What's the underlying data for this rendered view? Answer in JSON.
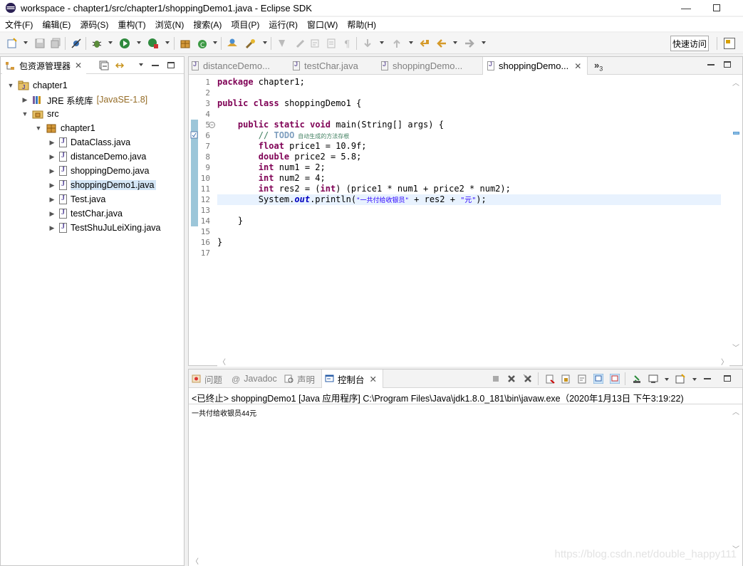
{
  "window": {
    "title": "workspace - chapter1/src/chapter1/shoppingDemo1.java - Eclipse SDK",
    "minimize": "—"
  },
  "menu": [
    "文件(F)",
    "编辑(E)",
    "源码(S)",
    "重构(T)",
    "浏览(N)",
    "搜索(A)",
    "项目(P)",
    "运行(R)",
    "窗口(W)",
    "帮助(H)"
  ],
  "toolbar": {
    "quick_access": "快速访问"
  },
  "explorer": {
    "tab_label": "包资源管理器",
    "tree": {
      "project": "chapter1",
      "jre": "JRE 系统库",
      "jre_version": "[JavaSE-1.8]",
      "src": "src",
      "package": "chapter1",
      "files": [
        "DataClass.java",
        "distanceDemo.java",
        "shoppingDemo.java",
        "shoppingDemo1.java",
        "Test.java",
        "testChar.java",
        "TestShuJuLeiXing.java"
      ],
      "selected_file": "shoppingDemo1.java"
    }
  },
  "editor": {
    "tabs": [
      "distanceDemo...",
      "testChar.java",
      "shoppingDemo...",
      "shoppingDemo..."
    ],
    "active_tab": 3,
    "overflow": "»",
    "overflow_count": "3",
    "line_numbers": [
      "1",
      "2",
      "3",
      "4",
      "5",
      "6",
      "7",
      "8",
      "9",
      "10",
      "11",
      "12",
      "13",
      "14",
      "15",
      "16",
      "17"
    ],
    "lines": {
      "l1_kw": "package",
      "l1_rest": " chapter1;",
      "l3_kw1": "public",
      "l3_kw2": "class",
      "l3_rest": " shoppingDemo1 {",
      "l5_kw1": "public",
      "l5_kw2": "static",
      "l5_kw3": "void",
      "l5_rest": " main(String[] args) {",
      "l6_todo": "TODO",
      "l6_cmt": " 自动生成的方法存根",
      "l7_kw": "float",
      "l7_rest": " price1 = 10.9f;",
      "l8_kw": "double",
      "l8_rest": " price2 = 5.8;",
      "l9_kw": "int",
      "l9_rest": " num1 = 2;",
      "l10_kw": "int",
      "l10_rest": " num2 = 4;",
      "l11_kw": "int",
      "l11_mid": " res2 = (",
      "l11_kw2": "int",
      "l11_rest": ") (price1 * num1 + price2 * num2);",
      "l12_a": "System.",
      "l12_fld": "out",
      "l12_b": ".println(",
      "l12_str": "\"一共付给收银员\"",
      "l12_c": " + res2 + ",
      "l12_str2": "\"元\"",
      "l12_d": ");",
      "l14": "}",
      "l16": "}"
    }
  },
  "console": {
    "tabs": [
      "问题",
      "Javadoc",
      "声明",
      "控制台"
    ],
    "status": "<已终止> shoppingDemo1 [Java 应用程序] C:\\Program Files\\Java\\jdk1.8.0_181\\bin\\javaw.exe（2020年1月13日 下午3:19:22)",
    "output": "一共付给收银员44元"
  },
  "watermark": "https://blog.csdn.net/double_happy111",
  "colors": {
    "keyword": "#7f0055",
    "string": "#2a00ff",
    "comment": "#3f7f5f",
    "selection": "#d4e6f6",
    "current_line": "#e8f2fe"
  }
}
